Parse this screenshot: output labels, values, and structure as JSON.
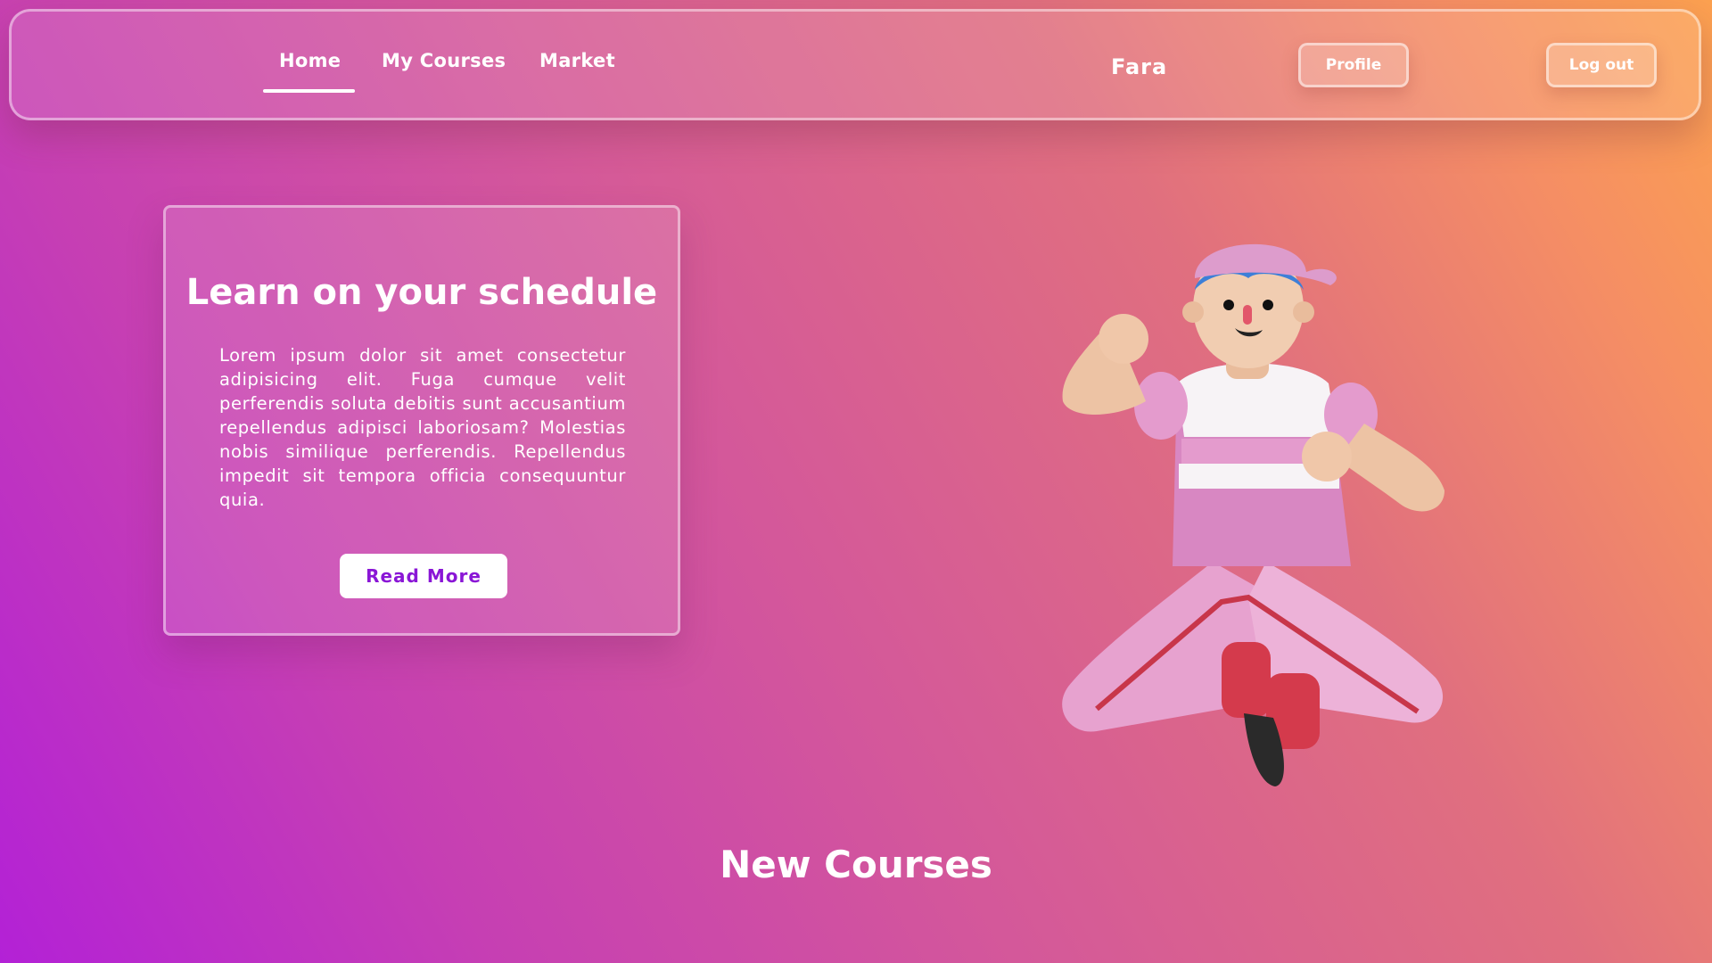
{
  "nav": {
    "links": [
      {
        "label": "Home",
        "active": true
      },
      {
        "label": "My Courses"
      },
      {
        "label": "Market"
      }
    ],
    "user_name": "Fara",
    "profile_label": "Profile",
    "logout_label": "Log out"
  },
  "hero": {
    "title": "Learn on your schedule",
    "body": "Lorem ipsum dolor sit amet consectetur adipisicing elit. Fuga cumque velit perferendis soluta debitis sunt accusantium repellendus adipisci laboriosam? Molestias nobis similique perferendis. Repellendus impedit sit tempora officia consequuntur quia.",
    "button_label": "Read More"
  },
  "sections": {
    "new_courses_title": "New Courses"
  },
  "colors": {
    "gradient_start": "#b321d6",
    "gradient_end": "#fca150",
    "button_text": "#8a16d6"
  }
}
